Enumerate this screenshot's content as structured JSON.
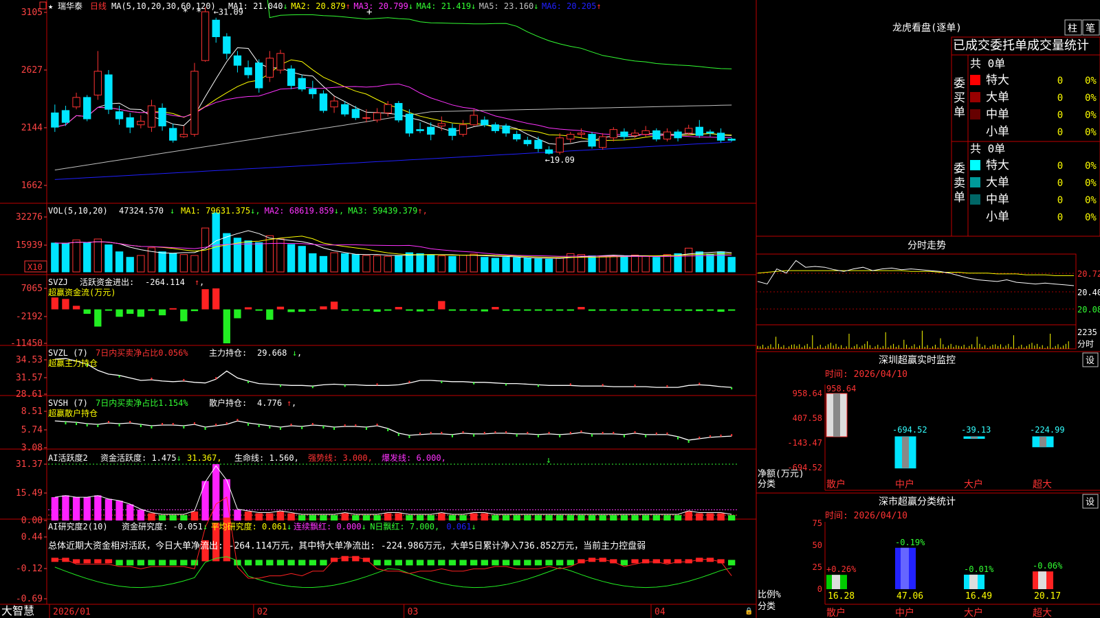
{
  "stock": {
    "star": "★",
    "name": "瑞华泰",
    "period": "日线"
  },
  "colors": {
    "up": "#ff3333",
    "down": "#00e5ff",
    "border": "#c00000",
    "axis": "#ff4444",
    "ma1": "#ffffff",
    "ma2": "#ffff00",
    "ma3": "#ff33ff",
    "ma4": "#33ff33",
    "ma5": "#c0c0c0",
    "ma6": "#2020ff"
  },
  "price_panel": {
    "ma_label": "MA(5,10,20,30,60,120)",
    "ma": [
      {
        "name": "MA1:",
        "value": "21.040",
        "arrow": "↓",
        "color": "#ffffff"
      },
      {
        "name": "MA2:",
        "value": "20.879",
        "arrow": "↑",
        "color": "#ffff00"
      },
      {
        "name": "MA3:",
        "value": "20.799",
        "arrow": "↓",
        "color": "#ff33ff"
      },
      {
        "name": "MA4:",
        "value": "21.419",
        "arrow": "↓",
        "color": "#33ff33"
      },
      {
        "name": "MA5:",
        "value": "23.160",
        "arrow": "↓",
        "color": "#c0c0c0"
      },
      {
        "name": "MA6:",
        "value": "20.205",
        "arrow": "↑",
        "color": "#2020ff"
      }
    ],
    "y_ticks": [
      "3105",
      "2627",
      "2144",
      "1662"
    ],
    "high_label": "31.09",
    "low_label": "19.09",
    "marks": [
      "*",
      "*",
      "+"
    ]
  },
  "vol_panel": {
    "label": "VOL(5,10,20)",
    "value": "47324.570",
    "value_arrow": "↓",
    "ma": [
      {
        "name": "MA1:",
        "value": "79631.375",
        "arrow": "↓",
        "color": "#ffff00"
      },
      {
        "name": "MA2:",
        "value": "68619.859",
        "arrow": "↓",
        "color": "#ff33ff"
      },
      {
        "name": "MA3:",
        "value": "59439.379",
        "arrow": "↑",
        "color": "#33ff33"
      }
    ],
    "y_ticks": [
      "32276",
      "15939"
    ],
    "unit": "X10"
  },
  "svzj_panel": {
    "label": "SVZJ",
    "item": "活跃资金进出:",
    "value": "-264.114",
    "arrow": "↑",
    "suffix": ",",
    "sub": "超赢资金流(万元)",
    "y_ticks": [
      "7065",
      "-2192",
      "-11450"
    ]
  },
  "svzl_panel": {
    "label": "SVZL (7)",
    "item1": "7日内买卖净占比0.056%",
    "item2": "主力持仓:",
    "value": "29.668",
    "arrow": "↓",
    "suffix": ",",
    "sub": "超赢主力持仓",
    "y_ticks": [
      "34.53",
      "31.57",
      "28.61"
    ]
  },
  "svsh_panel": {
    "label": "SVSH (7)",
    "item1": "7日内买卖净占比1.154%",
    "item2": "散户持仓:",
    "value": "4.776",
    "arrow": "↑",
    "suffix": ",",
    "sub": "超赢散户持仓",
    "y_ticks": [
      "8.51",
      "5.74",
      "3.08"
    ]
  },
  "ai_active_panel": {
    "label": "AI活跃度2",
    "items": [
      {
        "text": "资金活跃度: 1.475",
        "arrow": "↓",
        "color": "#ffffff"
      },
      {
        "text": "31.367",
        "arrow": ",",
        "color": "#ffff00"
      },
      {
        "text": "生命线: 1.560",
        "arrow": ",",
        "color": "#ffffff"
      },
      {
        "text": "强势线: 3.000",
        "arrow": ",",
        "color": "#ff3333"
      },
      {
        "text": "爆发线: 6.000",
        "arrow": ",",
        "color": "#ff33ff"
      }
    ],
    "y_ticks": [
      "31.37",
      "15.49",
      "0.00"
    ]
  },
  "ai_research_panel": {
    "label": "AI研究度2(10)",
    "items": [
      {
        "text": "资金研究度: -0.051",
        "arrow": "↓",
        "color": "#ffffff"
      },
      {
        "text": "平均研究度: 0.061",
        "arrow": "↓",
        "color": "#ffff00"
      },
      {
        "text": "连续飘红: 0.000",
        "arrow": "↓",
        "color": "#ff33ff"
      },
      {
        "text": "N日飘红: 7.000",
        "arrow": ",",
        "color": "#33ff33"
      },
      {
        "text": "0.061",
        "arrow": "↓",
        "color": "#2020ff"
      }
    ],
    "summary": "总体近期大资金相对活跃，今日大单净流出: -264.114万元，其中特大单净流出: -224.986万元，大单5日累计净入736.852万元，当前主力控盘弱",
    "y_ticks": [
      "0.44",
      "-0.12",
      "-0.69"
    ]
  },
  "x_axis": {
    "labels": [
      "2026/01",
      "02",
      "03",
      "04"
    ]
  },
  "bottom_bar": {
    "brand": "大智慧"
  },
  "dragon": {
    "title": "龙虎看盘(逐单)",
    "buttons": [
      "柱",
      "笔"
    ],
    "section_title": "已成交委托单成交量统计",
    "buy": {
      "side_label": "委买单",
      "total": "共 0单",
      "rows": [
        {
          "name": "特大",
          "qty": "0",
          "pct": "0%",
          "color": "#ff0000"
        },
        {
          "name": "大单",
          "qty": "0",
          "pct": "0%",
          "color": "#990000"
        },
        {
          "name": "中单",
          "qty": "0",
          "pct": "0%",
          "color": "#660000"
        },
        {
          "name": "小单",
          "qty": "0",
          "pct": "0%",
          "color": "#000000"
        }
      ]
    },
    "sell": {
      "side_label": "委卖单",
      "total": "共 0单",
      "rows": [
        {
          "name": "特大",
          "qty": "0",
          "pct": "0%",
          "color": "#00ffff"
        },
        {
          "name": "大单",
          "qty": "0",
          "pct": "0%",
          "color": "#009999"
        },
        {
          "name": "中单",
          "qty": "0",
          "pct": "0%",
          "color": "#006666"
        },
        {
          "name": "小单",
          "qty": "0",
          "pct": "0%",
          "color": "#000000"
        }
      ]
    }
  },
  "intraday": {
    "title": "分时走势",
    "y_labels": [
      "20.72",
      "20.40",
      "20.08"
    ],
    "vol_label": "2235",
    "vol_unit": "分时"
  },
  "realtime": {
    "title": "深圳超赢实时监控",
    "button": "设",
    "time": "时间: 2026/04/10",
    "y_ticks": [
      "958.64",
      "407.58",
      "-143.47",
      "-694.52"
    ],
    "ylabel1": "净额(万元)",
    "ylabel2": "分类",
    "categories": [
      "散户",
      "中户",
      "大户",
      "超大"
    ]
  },
  "classify": {
    "title": "深市超赢分类统计",
    "button": "设",
    "time": "时间: 2026/04/10",
    "y_ticks": [
      "75",
      "50",
      "25",
      "0"
    ],
    "ylabel1": "比例%",
    "ylabel2": "分类",
    "categories": [
      "散户",
      "中户",
      "大户",
      "超大"
    ]
  },
  "chart_data": [
    {
      "type": "candlestick",
      "title": "瑞华泰 日线",
      "x": [
        "2026/01",
        "02",
        "03",
        "04"
      ],
      "ylim": [
        16.62,
        31.05
      ],
      "candles": [
        [
          22.6,
          21.4,
          23.3,
          21.0
        ],
        [
          22.8,
          21.8,
          23.2,
          21.5
        ],
        [
          23.1,
          23.9,
          24.3,
          22.9
        ],
        [
          23.9,
          22.1,
          24.1,
          21.9
        ],
        [
          24.1,
          26.1,
          27.8,
          23.7
        ],
        [
          25.8,
          22.9,
          26.2,
          22.5
        ],
        [
          22.7,
          22.1,
          23.2,
          21.6
        ],
        [
          22.2,
          21.4,
          22.6,
          20.9
        ],
        [
          21.6,
          21.9,
          22.4,
          21.3
        ],
        [
          21.4,
          23.2,
          23.7,
          21.0
        ],
        [
          23.0,
          21.5,
          23.4,
          21.1
        ],
        [
          21.3,
          20.3,
          21.7,
          20.1
        ],
        [
          20.6,
          20.8,
          21.5,
          20.5
        ],
        [
          20.8,
          26.1,
          26.8,
          20.6
        ],
        [
          27.0,
          31.1,
          31.5,
          26.9
        ],
        [
          30.4,
          29.0,
          30.6,
          28.5
        ],
        [
          29.0,
          27.6,
          29.3,
          27.1
        ],
        [
          27.4,
          26.6,
          27.8,
          26.0
        ],
        [
          26.4,
          25.8,
          27.0,
          25.5
        ],
        [
          26.8,
          24.7,
          27.1,
          24.3
        ],
        [
          25.6,
          27.2,
          27.8,
          25.2
        ],
        [
          26.2,
          27.6,
          27.9,
          25.9
        ],
        [
          26.3,
          24.9,
          26.6,
          24.6
        ],
        [
          25.5,
          24.6,
          25.8,
          24.4
        ],
        [
          24.6,
          24.2,
          25.3,
          23.8
        ],
        [
          24.2,
          22.8,
          24.5,
          22.6
        ],
        [
          23.1,
          23.6,
          24.0,
          22.6
        ],
        [
          23.3,
          22.5,
          23.6,
          22.3
        ],
        [
          22.9,
          22.2,
          23.2,
          22.0
        ],
        [
          22.2,
          22.2,
          22.9,
          21.8
        ],
        [
          22.0,
          22.6,
          23.0,
          21.8
        ],
        [
          22.6,
          23.3,
          23.6,
          22.3
        ],
        [
          23.4,
          22.0,
          23.6,
          21.8
        ],
        [
          22.5,
          20.9,
          22.9,
          20.6
        ],
        [
          21.2,
          21.1,
          21.8,
          20.9
        ],
        [
          21.4,
          20.8,
          21.8,
          20.3
        ],
        [
          21.5,
          21.7,
          22.3,
          21.1
        ],
        [
          21.3,
          20.7,
          21.7,
          20.3
        ],
        [
          20.8,
          21.6,
          22.0,
          20.6
        ],
        [
          21.6,
          22.4,
          22.9,
          21.5
        ],
        [
          22.0,
          21.6,
          22.3,
          21.4
        ],
        [
          21.6,
          21.1,
          21.8,
          20.9
        ],
        [
          21.5,
          20.9,
          21.7,
          20.6
        ],
        [
          20.8,
          20.4,
          21.1,
          20.2
        ],
        [
          20.3,
          20.0,
          20.6,
          19.8
        ],
        [
          20.3,
          19.6,
          20.6,
          19.3
        ],
        [
          19.5,
          19.2,
          19.8,
          19.09
        ],
        [
          19.3,
          20.5,
          20.9,
          19.1
        ],
        [
          20.4,
          20.8,
          21.0,
          20.1
        ],
        [
          20.8,
          20.9,
          21.3,
          20.5
        ],
        [
          20.8,
          19.8,
          21.0,
          19.6
        ],
        [
          19.7,
          20.6,
          20.9,
          19.5
        ],
        [
          20.5,
          21.2,
          21.4,
          20.2
        ],
        [
          21.0,
          20.6,
          21.3,
          20.3
        ],
        [
          20.7,
          20.9,
          21.2,
          20.5
        ],
        [
          20.8,
          21.1,
          21.5,
          20.6
        ],
        [
          21.1,
          20.4,
          21.3,
          20.2
        ],
        [
          20.4,
          21.0,
          21.3,
          20.2
        ],
        [
          21.0,
          20.5,
          21.2,
          20.2
        ],
        [
          20.9,
          21.3,
          21.6,
          20.7
        ],
        [
          21.4,
          20.7,
          22.0,
          20.5
        ],
        [
          21.0,
          20.9,
          21.2,
          20.6
        ],
        [
          20.9,
          20.3,
          21.3,
          20.1
        ],
        [
          20.4,
          20.3,
          20.5,
          20.2
        ]
      ]
    },
    {
      "type": "bar",
      "title": "VOL(5,10,20)",
      "ylim": [
        0,
        32276
      ],
      "volumes": [
        15800,
        15500,
        17500,
        15800,
        18000,
        14800,
        11000,
        8000,
        9000,
        13200,
        11000,
        10000,
        9500,
        9000,
        24000,
        32276,
        21000,
        18500,
        17000,
        16000,
        19800,
        18000,
        15000,
        14000,
        10000,
        8500,
        10500,
        10000,
        9500,
        9000,
        8800,
        8500,
        9000,
        10500,
        10000,
        9200,
        8800,
        8500,
        9200,
        9800,
        8000,
        7500,
        8000,
        7800,
        7500,
        7200,
        7000,
        7500,
        10000,
        9500,
        8800,
        8500,
        9000,
        8800,
        9200,
        8800,
        8000,
        9500,
        10000,
        13000,
        11000,
        9800,
        11000,
        8000
      ],
      "ma_lines": [
        "MA1",
        "MA2",
        "MA3"
      ]
    },
    {
      "type": "bar",
      "title": "超赢资金流(万元)",
      "ylim": [
        -11450,
        7065
      ],
      "values": [
        4000,
        3500,
        1200,
        -1500,
        -5800,
        -400,
        -2500,
        -1500,
        -2500,
        -500,
        -2000,
        400,
        -4000,
        -600,
        6800,
        7065,
        -11450,
        -3000,
        700,
        -300,
        -3500,
        900,
        -900,
        -800,
        -400,
        1000,
        2600,
        -200,
        -300,
        -400,
        -800,
        -300,
        800,
        -300,
        -700,
        -300,
        2800,
        -200,
        -400,
        -300,
        -700,
        800,
        -500,
        -400,
        -300,
        -300,
        -200,
        -300,
        -200,
        800,
        -500,
        -300,
        -400,
        -200,
        -400,
        -300,
        -200,
        -200,
        -300,
        -500,
        -600,
        -400,
        -800,
        -300
      ]
    },
    {
      "type": "line",
      "title": "超赢主力持仓",
      "ylim": [
        28.61,
        34.53
      ],
      "values": [
        34.2,
        34.3,
        33.9,
        33.4,
        32.4,
        31.8,
        31.6,
        31.2,
        30.8,
        30.9,
        30.7,
        30.6,
        30.7,
        30.5,
        30.4,
        31.0,
        32.3,
        31.2,
        30.7,
        30.3,
        30.2,
        30.1,
        30.0,
        30.0,
        29.9,
        30.1,
        30.2,
        30.1,
        30.1,
        30.0,
        30.0,
        30.0,
        30.1,
        30.4,
        30.8,
        30.8,
        30.7,
        30.6,
        30.6,
        30.5,
        30.5,
        30.4,
        30.3,
        30.3,
        30.2,
        30.1,
        30.0,
        30.0,
        30.0,
        29.9,
        29.9,
        29.9,
        29.8,
        29.8,
        29.8,
        29.8,
        29.7,
        29.7,
        29.7,
        30.0,
        30.1,
        30.0,
        29.8,
        29.7
      ]
    },
    {
      "type": "line",
      "title": "超赢散户持仓",
      "ylim": [
        3.08,
        8.51
      ],
      "values": [
        7.0,
        6.9,
        6.8,
        6.6,
        6.5,
        6.7,
        6.6,
        6.7,
        6.5,
        6.3,
        6.4,
        6.4,
        6.3,
        6.5,
        6.1,
        6.3,
        6.5,
        7.0,
        6.7,
        6.5,
        6.3,
        6.1,
        6.3,
        6.2,
        6.4,
        6.3,
        6.1,
        6.2,
        6.2,
        6.1,
        6.3,
        5.9,
        5.2,
        4.9,
        5.0,
        5.1,
        5.1,
        5.0,
        5.2,
        5.1,
        5.1,
        5.2,
        5.2,
        5.1,
        5.1,
        5.0,
        5.1,
        5.0,
        5.1,
        5.3,
        5.1,
        5.1,
        5.1,
        5.0,
        5.2,
        5.0,
        5.0,
        5.0,
        4.7,
        4.2,
        4.4,
        4.6,
        4.7,
        4.776
      ]
    },
    {
      "type": "bar",
      "title": "AI活跃度2",
      "ylim": [
        0,
        31.37
      ],
      "values": [
        13,
        14,
        13,
        13,
        14,
        12,
        11,
        9,
        6,
        4,
        3,
        3,
        3,
        5,
        22,
        31.37,
        23,
        6,
        5,
        4,
        4,
        5,
        4,
        3,
        3,
        3,
        3,
        4,
        3,
        3,
        3,
        4,
        4,
        3,
        3,
        3,
        4,
        3,
        3,
        4,
        4,
        3,
        3,
        3,
        3,
        3,
        3,
        3,
        3,
        3,
        3,
        3,
        3,
        3,
        3,
        3,
        3,
        3,
        3,
        5,
        4,
        4,
        4,
        3
      ],
      "lines": {
        "生命线": 1.56,
        "强势线": 3.0,
        "爆发线": 6.0
      }
    },
    {
      "type": "bar",
      "title": "AI研究度2(10)",
      "ylim": [
        -0.69,
        0.44
      ],
      "values": [
        0.02,
        0.02,
        0.0,
        0.0,
        0.0,
        0.0,
        -0.01,
        -0.01,
        -0.02,
        -0.01,
        -0.01,
        -0.01,
        -0.01,
        -0.02,
        0.12,
        0.22,
        0.25,
        -0.05,
        -0.06,
        -0.06,
        -0.05,
        -0.05,
        -0.04,
        -0.05,
        -0.03,
        -0.03,
        0.02,
        0.03,
        0.03,
        0.02,
        -0.02,
        -0.03,
        -0.03,
        -0.04,
        -0.03,
        -0.03,
        -0.02,
        -0.03,
        -0.03,
        -0.02,
        -0.02,
        -0.01,
        -0.01,
        -0.02,
        -0.02,
        -0.02,
        -0.01,
        -0.02,
        -0.01,
        0.01,
        0.02,
        0.02,
        0.01,
        -0.01,
        0.0,
        0.01,
        0.01,
        0.0,
        0.01,
        0.01,
        0.02,
        0.02,
        0.01,
        -0.05
      ]
    },
    {
      "type": "bar",
      "title": "深圳超赢实时监控",
      "categories": [
        "散户",
        "中户",
        "大户",
        "超大"
      ],
      "values": [
        958.64,
        -694.52,
        -39.13,
        -224.99
      ],
      "value_labels": [
        "958.64",
        "-694.52",
        "-39.13",
        "-224.99"
      ],
      "ylim": [
        -694.52,
        958.64
      ]
    },
    {
      "type": "bar",
      "title": "深市超赢分类统计",
      "categories": [
        "散户",
        "中户",
        "大户",
        "超大"
      ],
      "values": [
        16.28,
        47.06,
        16.49,
        20.17
      ],
      "change_labels": [
        "+0.26%",
        "-0.19%",
        "-0.01%",
        "-0.06%"
      ],
      "bar_colors": [
        "#00cc00",
        "#2222ff",
        "#00e5ff",
        "#ff2222"
      ],
      "ylim": [
        0,
        75
      ]
    },
    {
      "type": "line",
      "title": "分时走势",
      "ylim": [
        20.08,
        20.72
      ],
      "price": [
        20.45,
        20.42,
        20.6,
        20.55,
        20.7,
        20.62,
        20.63,
        20.62,
        20.59,
        20.57,
        20.6,
        20.62,
        20.58,
        20.6,
        20.61,
        20.59,
        20.6,
        20.59,
        20.58,
        20.57,
        20.55,
        20.52,
        20.49,
        20.47,
        20.46,
        20.45,
        20.47,
        20.44,
        20.43,
        20.42,
        20.43,
        20.42,
        20.41,
        20.4
      ],
      "avg": [
        20.55,
        20.56,
        20.57,
        20.58,
        20.58,
        20.58,
        20.58,
        20.58,
        20.58,
        20.58,
        20.58,
        20.58,
        20.58,
        20.58,
        20.58,
        20.58,
        20.57,
        20.57,
        20.57,
        20.56,
        20.56,
        20.56,
        20.55,
        20.55,
        20.55,
        20.54,
        20.54,
        20.54,
        20.53,
        20.53,
        20.53,
        20.52,
        20.52,
        20.52
      ]
    }
  ]
}
